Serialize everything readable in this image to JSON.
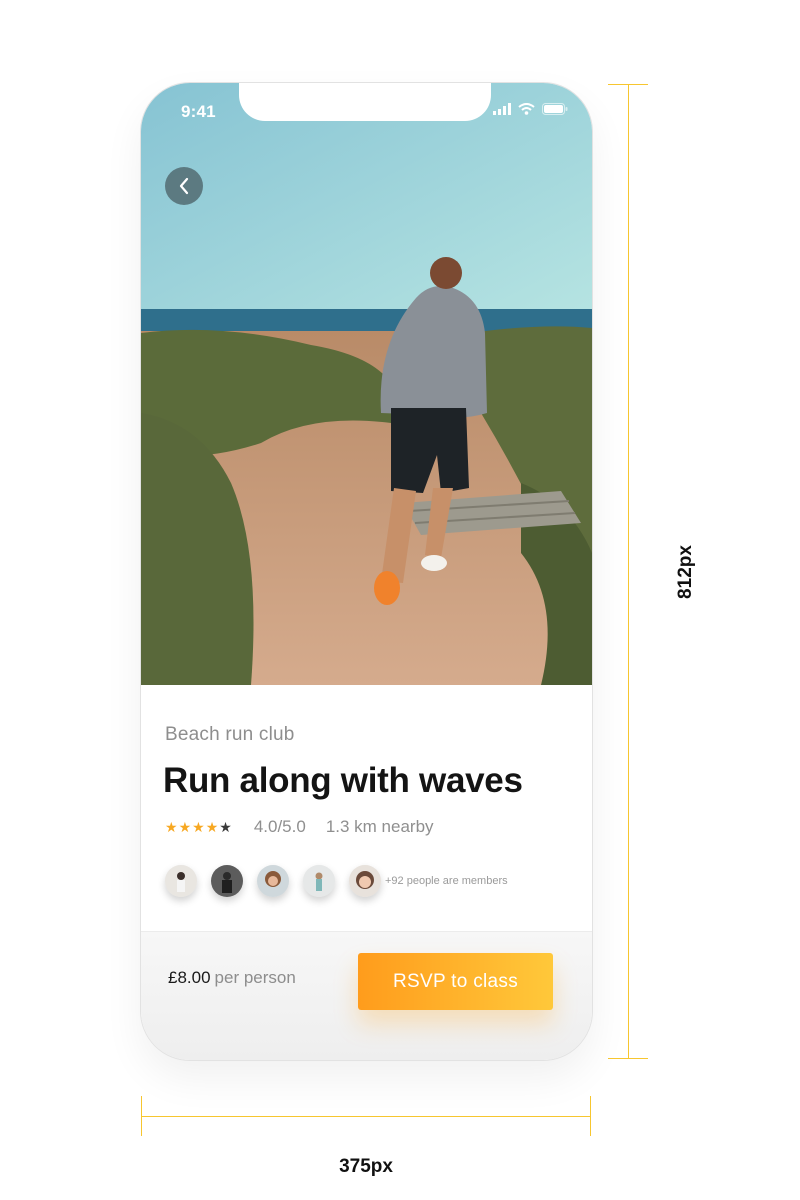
{
  "status_bar": {
    "time": "9:41"
  },
  "event": {
    "club_name": "Beach run club",
    "title": "Run along with waves",
    "rating_stars": 4,
    "rating_max": 5,
    "rating_text": "4.0/5.0",
    "distance": "1.3 km nearby",
    "members_text": "+92 people are members"
  },
  "booking": {
    "price": "£8.00",
    "price_unit": "per person",
    "rsvp_label": "RSVP to class"
  },
  "annotations": {
    "width_label": "375px",
    "height_label": "812px"
  },
  "colors": {
    "accent_start": "#ff9c1c",
    "accent_end": "#ffc83a",
    "star": "#f7a822",
    "dimension_line": "#f7c62f"
  }
}
